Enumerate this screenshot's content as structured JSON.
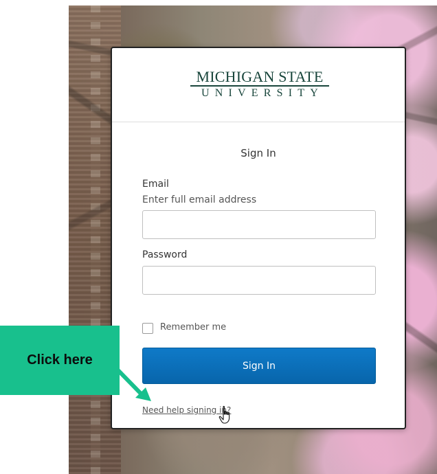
{
  "logo": {
    "line1": "MICHIGAN STATE",
    "line2": "UNIVERSITY"
  },
  "signin": {
    "title": "Sign In",
    "email_label": "Email",
    "email_hint": "Enter full email address",
    "email_value": "",
    "password_label": "Password",
    "password_value": "",
    "remember_label": "Remember me",
    "button_label": "Sign In",
    "help_link": "Need help signing in?"
  },
  "annotation": {
    "text": "Click here",
    "color": "#18c08d"
  },
  "colors": {
    "brand": "#18453b",
    "button": "#0865ab"
  },
  "icons": {
    "cursor": "hand-pointer-icon",
    "checkbox": "checkbox-icon",
    "arrow": "arrow-icon"
  }
}
